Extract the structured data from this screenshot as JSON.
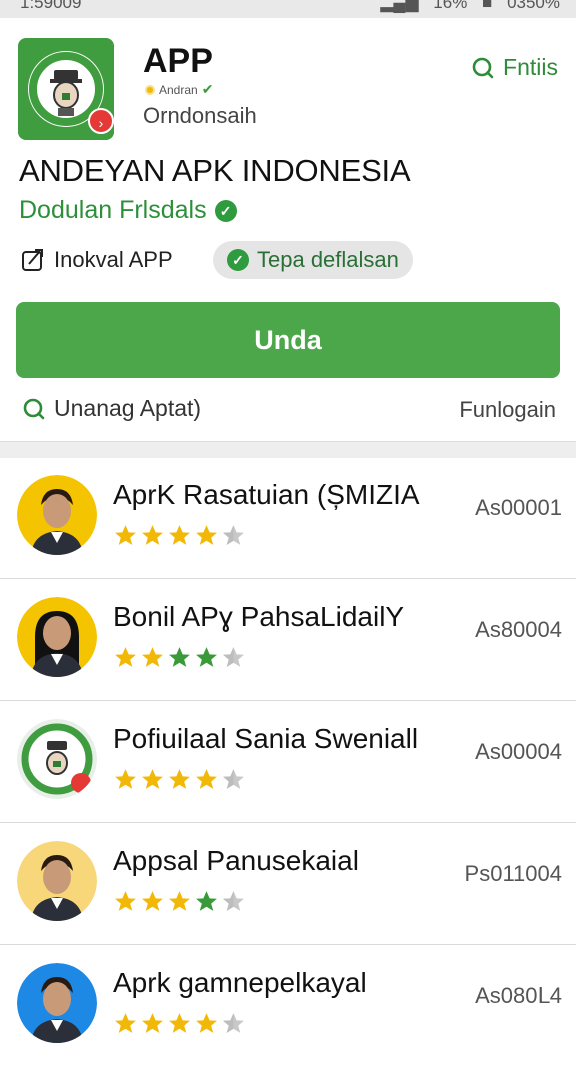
{
  "status_bar": {
    "time": "1:59009",
    "battery_percent": "16%",
    "right_text": "0350%"
  },
  "header": {
    "app_name": "APP",
    "developer_tag": "Andran",
    "subtitle": "Orndonsaih",
    "top_action_label": "Fntiis"
  },
  "headline": "ANDEYAN APK INDONESIA",
  "developer_link": "Dodulan Frlsdals",
  "chips": {
    "install_label": "Inokval APP",
    "verified_label": "Tepa deflalsan"
  },
  "main_button_label": "Unda",
  "sub_row": {
    "left_label": "Unanag Aptat)",
    "right_label": "Funlogain"
  },
  "colors": {
    "brand_green": "#4ca64a",
    "text_green": "#2e8f3a",
    "star_gold": "#f2b807",
    "star_green": "#3a9a3a",
    "avatar_bg_yellow": "#f5c400",
    "avatar_bg_blue": "#1e88e5"
  },
  "list_items": [
    {
      "title": "AprK Rasatuian (ȘMIZIA",
      "value": "As00001",
      "rating": 4.5,
      "avatar_icon": "person-man-icon",
      "star_tint": "gold"
    },
    {
      "title": "Bonil APɣ PahsaLidailY",
      "value": "As80004",
      "rating": 4.5,
      "avatar_icon": "person-woman-icon",
      "star_tint": "mixed"
    },
    {
      "title": "Pofiuilaal Sania Sweniall",
      "value": "As00004",
      "rating": 4.5,
      "avatar_icon": "app-logo-icon",
      "star_tint": "gold"
    },
    {
      "title": "Appsal Panusekaial",
      "value": "Ps011004",
      "rating": 4.5,
      "avatar_icon": "person-man-icon",
      "star_tint": "mixed2"
    },
    {
      "title": "Aprk ɡamnepelkayal",
      "value": "As080ᒪ4",
      "rating": 4.5,
      "avatar_icon": "person-man-icon",
      "star_tint": "gold"
    }
  ]
}
